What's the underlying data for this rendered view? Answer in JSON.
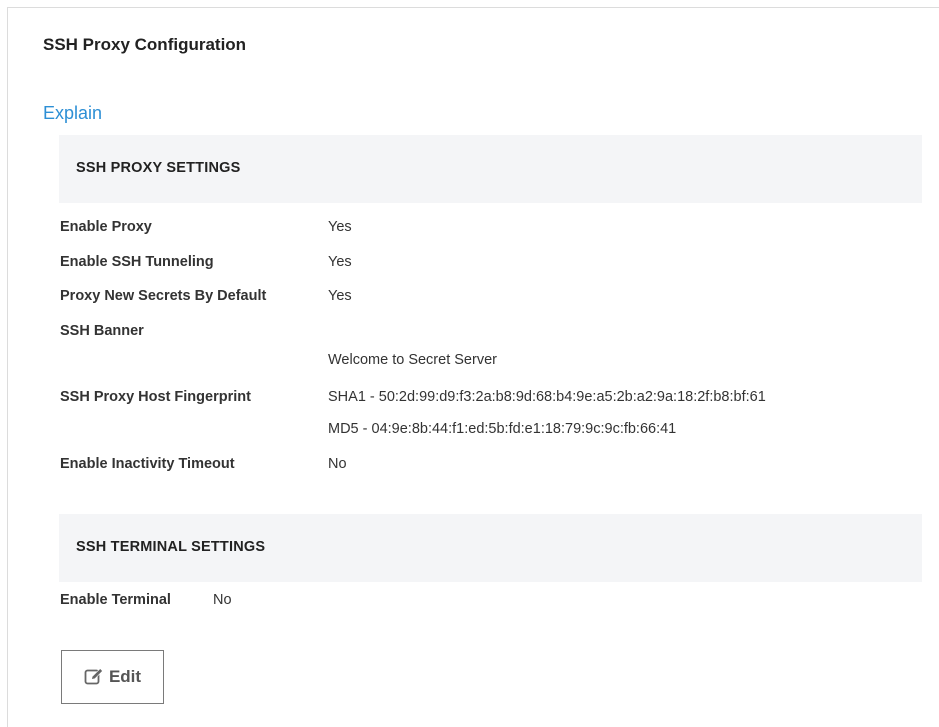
{
  "page": {
    "title": "SSH Proxy Configuration",
    "explain_link": "Explain"
  },
  "proxy_settings": {
    "header": "SSH PROXY SETTINGS",
    "enable_proxy": {
      "label": "Enable Proxy",
      "value": "Yes"
    },
    "enable_tunneling": {
      "label": "Enable SSH Tunneling",
      "value": "Yes"
    },
    "proxy_new_secrets": {
      "label": "Proxy New Secrets By Default",
      "value": "Yes"
    },
    "ssh_banner": {
      "label": "SSH Banner",
      "value": "Welcome to Secret Server"
    },
    "host_fingerprint": {
      "label": "SSH Proxy Host Fingerprint",
      "sha1": "SHA1 - 50:2d:99:d9:f3:2a:b8:9d:68:b4:9e:a5:2b:a2:9a:18:2f:b8:bf:61",
      "md5": "MD5 - 04:9e:8b:44:f1:ed:5b:fd:e1:18:79:9c:9c:fb:66:41"
    },
    "inactivity_timeout": {
      "label": "Enable Inactivity Timeout",
      "value": "No"
    }
  },
  "terminal_settings": {
    "header": "SSH TERMINAL SETTINGS",
    "enable_terminal": {
      "label": "Enable Terminal",
      "value": "No"
    }
  },
  "actions": {
    "edit_label": "Edit",
    "edit_icon": "edit-icon"
  },
  "colors": {
    "link": "#2d8fd5",
    "section_bg": "#f4f5f7",
    "border": "#7a7a7a"
  }
}
